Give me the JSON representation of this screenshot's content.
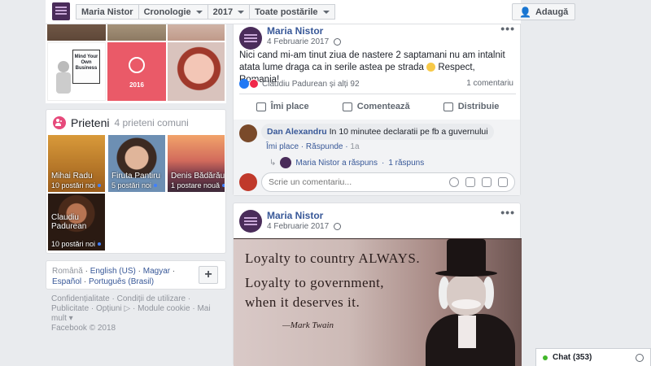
{
  "header": {
    "breadcrumb": [
      "Maria Nistor",
      "Cronologie",
      "2017",
      "Toate postările"
    ],
    "add_label": "Adaugă"
  },
  "photos": {
    "mind_your_business": "Mind Your Own Business",
    "badge_2016": "2016"
  },
  "friends": {
    "title": "Prieteni",
    "mutual": "4 prieteni comuni",
    "items": [
      {
        "name": "Mihai Radu",
        "count": "10 postări noi"
      },
      {
        "name": "Firuta Pantiru",
        "count": "5 postări noi"
      },
      {
        "name": "Denis Bădărău",
        "count": "1 postare nouă"
      },
      {
        "name": "Claudiu Padurean",
        "count": "10 postări noi"
      }
    ]
  },
  "languages": {
    "current": "Română",
    "others": [
      "English (US)",
      "Magyar",
      "Español",
      "Português (Brasil)"
    ]
  },
  "footer": {
    "links": [
      "Confidențialitate",
      "Condiții de utilizare",
      "Publicitate",
      "Opțiuni",
      "Module cookie",
      "Mai mult"
    ],
    "copyright": "Facebook © 2018"
  },
  "post1": {
    "author": "Maria Nistor",
    "date": "4 Februarie 2017",
    "text": "Nici cand mi-am tinut ziua de nastere 2 saptamani nu am intalnit atata lume draga ca in serile astea pe strada",
    "text_end": "Respect, Romania!",
    "reactions": "Claudiu Padurean și alți 92",
    "comments_count": "1 comentariu",
    "actions": [
      "Îmi place",
      "Comentează",
      "Distribuie"
    ],
    "comment": {
      "author": "Dan Alexandru",
      "text": "In 10 minutee declaratii pe fb a guvernului",
      "like": "Îmi place",
      "reply": "Răspunde",
      "time": "1a"
    },
    "reply_summary": "Maria Nistor a răspuns",
    "reply_count": "1 răspuns",
    "comment_placeholder": "Scrie un comentariu..."
  },
  "post2": {
    "author": "Maria Nistor",
    "date": "4 Februarie 2017",
    "quote": [
      "Loyalty to country ALWAYS.",
      "Loyalty to government,",
      "when it deserves it.",
      "—Mark Twain"
    ]
  },
  "chat": {
    "label": "Chat (353)",
    "status_color": "#42b72a"
  }
}
